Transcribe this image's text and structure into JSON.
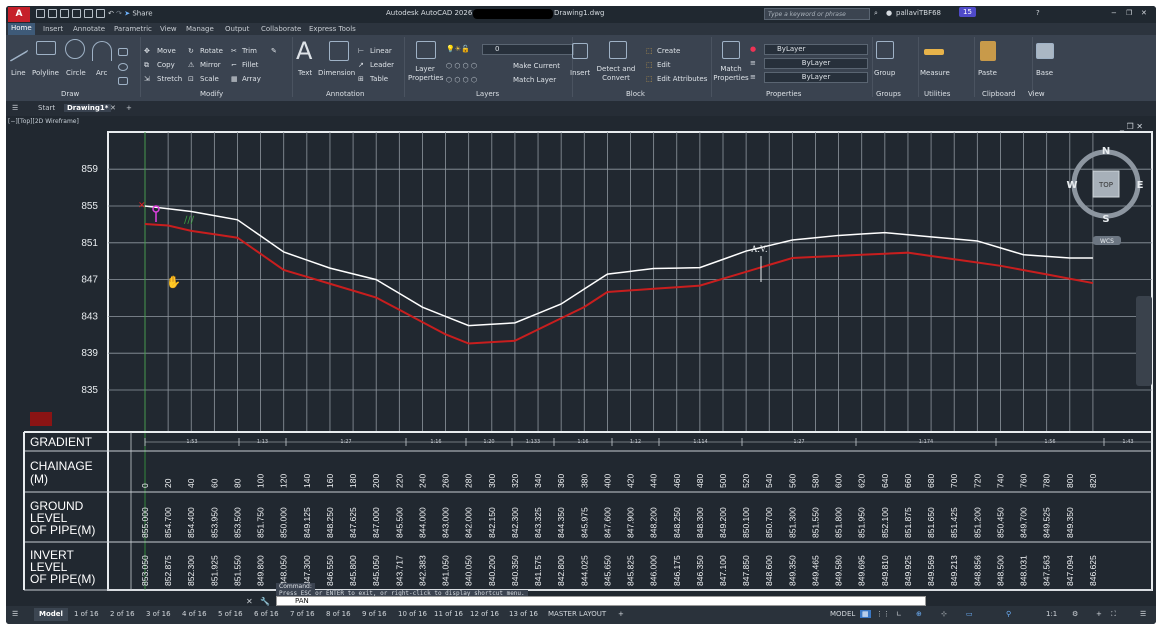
{
  "title": {
    "app": "Autodesk AutoCAD 2026",
    "file": "Drawing1.dwg",
    "share": "Share",
    "search_placeholder": "Type a keyword or phrase",
    "user": "pallaviTBF68",
    "badge": "15"
  },
  "tabs": [
    "Home",
    "Insert",
    "Annotate",
    "Parametric",
    "View",
    "Manage",
    "Output",
    "Collaborate",
    "Express Tools"
  ],
  "ribbon": {
    "draw": {
      "line": "Line",
      "polyline": "Polyline",
      "circle": "Circle",
      "arc": "Arc",
      "group": "Draw"
    },
    "modify": {
      "move": "Move",
      "rotate": "Rotate",
      "trim": "Trim",
      "copy": "Copy",
      "mirror": "Mirror",
      "fillet": "Fillet",
      "stretch": "Stretch",
      "scale": "Scale",
      "array": "Array",
      "group": "Modify"
    },
    "annotation": {
      "text": "Text",
      "dimension": "Dimension",
      "linear": "Linear",
      "leader": "Leader",
      "table": "Table",
      "group": "Annotation"
    },
    "layers": {
      "props": "Layer Properties",
      "layer_value": "0",
      "make_current": "Make Current",
      "match_layer": "Match Layer",
      "group": "Layers"
    },
    "block": {
      "insert": "Insert",
      "detect": "Detect and Convert",
      "create": "Create",
      "edit": "Edit",
      "edit_attr": "Edit Attributes",
      "group": "Block"
    },
    "properties": {
      "match": "Match Properties",
      "bylayer1": "ByLayer",
      "bylayer2": "ByLayer",
      "bylayer3": "ByLayer",
      "group": "Properties"
    },
    "groups": {
      "group_btn": "Group",
      "group": "Groups"
    },
    "utilities": {
      "measure": "Measure",
      "group": "Utilities"
    },
    "clipboard": {
      "paste": "Paste",
      "group": "Clipboard"
    },
    "view": {
      "base": "Base",
      "group": "View"
    }
  },
  "filetabs": {
    "start": "Start",
    "drawing": "Drawing1*"
  },
  "viewport": {
    "label": "[−][Top][2D Wireframe]"
  },
  "viewcube": {
    "n": "N",
    "s": "S",
    "e": "E",
    "w": "W",
    "top": "TOP",
    "wcs": "WCS"
  },
  "chart_data": {
    "type": "line",
    "yticks": [
      "859",
      "855",
      "851",
      "847",
      "843",
      "839",
      "835"
    ],
    "y_range": [
      835,
      859
    ],
    "x": [
      0,
      20,
      40,
      60,
      80,
      100,
      120,
      140,
      160,
      180,
      200,
      220,
      240,
      260,
      280,
      300,
      320,
      340,
      360,
      380,
      400,
      420,
      440,
      460,
      480,
      500,
      520,
      540,
      560,
      580,
      600,
      620,
      640,
      660,
      680,
      700,
      720,
      740,
      760,
      780,
      800,
      820
    ],
    "series": [
      {
        "name": "ground",
        "color": "#ffffff",
        "values": [
          855.0,
          854.7,
          854.4,
          853.95,
          853.5,
          851.75,
          850.0,
          849.125,
          848.25,
          847.625,
          847.0,
          845.5,
          844.0,
          843.0,
          842.0,
          842.15,
          842.3,
          843.325,
          844.35,
          845.975,
          847.6,
          847.9,
          848.2,
          848.25,
          848.3,
          849.2,
          850.1,
          850.7,
          851.3,
          851.55,
          851.8,
          851.95,
          852.1,
          851.875,
          851.65,
          851.425,
          851.2,
          850.45,
          849.7,
          849.525,
          849.35,
          849.35
        ]
      },
      {
        "name": "invert",
        "color": "#c81e1e",
        "values": [
          853.05,
          852.875,
          852.3,
          851.925,
          851.55,
          849.8,
          848.05,
          847.3,
          846.55,
          845.8,
          845.05,
          843.717,
          842.383,
          841.05,
          840.05,
          840.2,
          840.35,
          841.575,
          842.8,
          844.025,
          845.65,
          845.825,
          846.0,
          846.175,
          846.35,
          847.1,
          847.85,
          848.6,
          849.35,
          849.465,
          849.58,
          849.695,
          849.81,
          849.925,
          849.569,
          849.213,
          848.856,
          848.5,
          848.031,
          847.563,
          847.094,
          846.625
        ]
      }
    ],
    "av_label": "A.V."
  },
  "table": {
    "labels": {
      "gradient": "GRADIENT",
      "chainage1": "CHAINAGE",
      "chainage2": "(M)",
      "ground1": "GROUND",
      "ground2": "LEVEL",
      "ground3": "OF PIPE(M)",
      "invert1": "INVERT",
      "invert2": "LEVEL",
      "invert3": "OF PIPE(M)"
    },
    "chainage": [
      "0",
      "20",
      "40",
      "60",
      "80",
      "100",
      "120",
      "140",
      "160",
      "180",
      "200",
      "220",
      "240",
      "260",
      "280",
      "300",
      "320",
      "340",
      "360",
      "380",
      "400",
      "420",
      "440",
      "460",
      "480",
      "500",
      "520",
      "540",
      "560",
      "580",
      "600",
      "620",
      "640",
      "660",
      "680",
      "700",
      "720",
      "740",
      "760",
      "780",
      "800",
      "820"
    ],
    "ground": [
      "855.000",
      "854.700",
      "854.400",
      "853.950",
      "853.500",
      "851.750",
      "850.000",
      "849.125",
      "848.250",
      "847.625",
      "847.000",
      "845.500",
      "844.000",
      "843.000",
      "842.000",
      "842.150",
      "842.300",
      "843.325",
      "844.350",
      "845.975",
      "847.600",
      "847.900",
      "848.200",
      "848.250",
      "848.300",
      "849.200",
      "850.100",
      "850.700",
      "851.300",
      "851.550",
      "851.800",
      "851.950",
      "852.100",
      "851.875",
      "851.650",
      "851.425",
      "851.200",
      "850.450",
      "849.700",
      "849.525",
      "849.350",
      ""
    ],
    "invert": [
      "853.050",
      "852.875",
      "852.300",
      "851.925",
      "851.550",
      "849.800",
      "848.050",
      "847.300",
      "846.550",
      "845.800",
      "845.050",
      "843.717",
      "842.383",
      "841.050",
      "840.050",
      "840.200",
      "840.350",
      "841.575",
      "842.800",
      "844.025",
      "845.650",
      "845.825",
      "846.000",
      "846.175",
      "846.350",
      "847.100",
      "847.850",
      "848.600",
      "849.350",
      "849.465",
      "849.580",
      "849.695",
      "849.810",
      "849.925",
      "849.569",
      "849.213",
      "848.856",
      "848.500",
      "848.031",
      "847.563",
      "847.094",
      "846.625"
    ],
    "gradients": [
      "1:53",
      "1:13",
      "1:27",
      "1:16",
      "1:20",
      "1:133",
      "1:16",
      "1:12",
      "1:114",
      "1:27",
      "1:174",
      "1:56",
      "1:43"
    ]
  },
  "command": {
    "history_label": "Command:",
    "history": "Press ESC or ENTER to exit, or right-click to display shortcut menu.",
    "value": "PAN"
  },
  "layouts": {
    "model": "Model",
    "pages": [
      "1 of 16",
      "2 of 16",
      "3 of 16",
      "4 of 16",
      "5 of 16",
      "6 of 16",
      "7 of 16",
      "8 of 16",
      "9 of 16",
      "10 of 16",
      "11 of 16",
      "12 of 16",
      "13 of 16"
    ],
    "master": "MASTER LAYOUT",
    "model_btn": "MODEL",
    "scale": "1:1"
  }
}
